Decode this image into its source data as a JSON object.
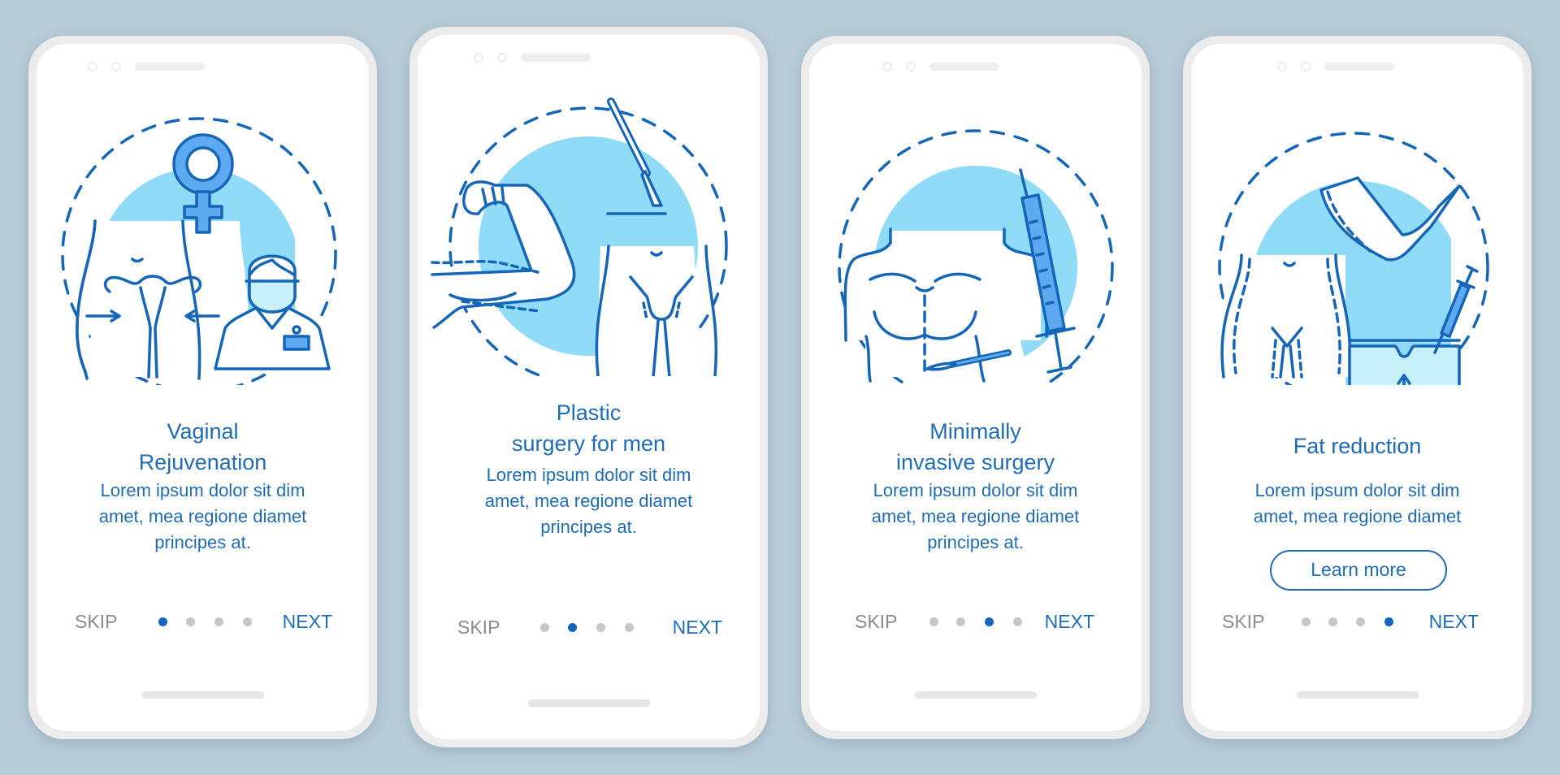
{
  "colors": {
    "background": "#b8ccd8",
    "accent": "#1f6cb5",
    "stroke": "#1565b8",
    "fill_light": "#8fdbf8",
    "fill_mid": "#5eaaf0",
    "fill_pale": "#c8f0fb",
    "dot_inactive": "#c6c6c6",
    "skip_text": "#8b8b8b"
  },
  "screens": [
    {
      "illustration": "vaginal-rejuvenation-illustration",
      "title_lines": [
        "Vaginal",
        "Rejuvenation"
      ],
      "body_lines": [
        "Lorem ipsum dolor sit dim",
        "amet, mea regione diamet",
        "principes at."
      ],
      "skip_label": "SKIP",
      "next_label": "NEXT",
      "page_index": 1,
      "page_count": 4
    },
    {
      "illustration": "plastic-surgery-men-illustration",
      "title_lines": [
        "Plastic",
        "surgery for men"
      ],
      "body_lines": [
        "Lorem ipsum dolor sit dim",
        "amet, mea regione diamet",
        "principes at."
      ],
      "skip_label": "SKIP",
      "next_label": "NEXT",
      "page_index": 2,
      "page_count": 4
    },
    {
      "illustration": "minimally-invasive-surgery-illustration",
      "title_lines": [
        "Minimally",
        "invasive surgery"
      ],
      "body_lines": [
        "Lorem ipsum dolor sit dim",
        "amet, mea regione diamet",
        "principes at."
      ],
      "skip_label": "SKIP",
      "next_label": "NEXT",
      "page_index": 3,
      "page_count": 4
    },
    {
      "illustration": "fat-reduction-illustration",
      "title_lines": [
        "Fat reduction"
      ],
      "body_lines": [
        "Lorem ipsum dolor sit dim",
        "amet, mea regione diamet"
      ],
      "button_label": "Learn more",
      "skip_label": "SKIP",
      "next_label": "NEXT",
      "page_index": 4,
      "page_count": 4
    }
  ]
}
